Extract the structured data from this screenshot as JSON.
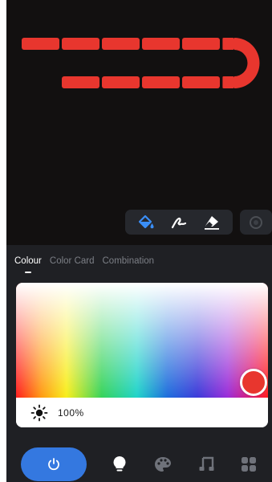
{
  "strip": {
    "color": "#e8362e"
  },
  "toolbar": {
    "tools": [
      {
        "icon": "paint-bucket-icon",
        "active": true,
        "color": "#3a8ef6"
      },
      {
        "icon": "brush-icon",
        "active": false,
        "color": "#ffffff"
      },
      {
        "icon": "eraser-icon",
        "active": false,
        "color": "#ffffff"
      }
    ],
    "extra_icon": "circle-tool-icon"
  },
  "tabs": [
    {
      "label": "Colour",
      "active": true
    },
    {
      "label": "Color Card",
      "active": false
    },
    {
      "label": "Combination",
      "active": false
    }
  ],
  "picker": {
    "selected_color": "#e8362e",
    "brightness_icon": "sun-icon",
    "brightness_value": "100%"
  },
  "nav": {
    "power_icon": "power-icon",
    "power_color": "#3478e0",
    "items": [
      {
        "icon": "bulb-icon",
        "active": true
      },
      {
        "icon": "palette-icon",
        "active": false
      },
      {
        "icon": "music-icon",
        "active": false
      },
      {
        "icon": "scenes-grid-icon",
        "active": false
      }
    ]
  }
}
